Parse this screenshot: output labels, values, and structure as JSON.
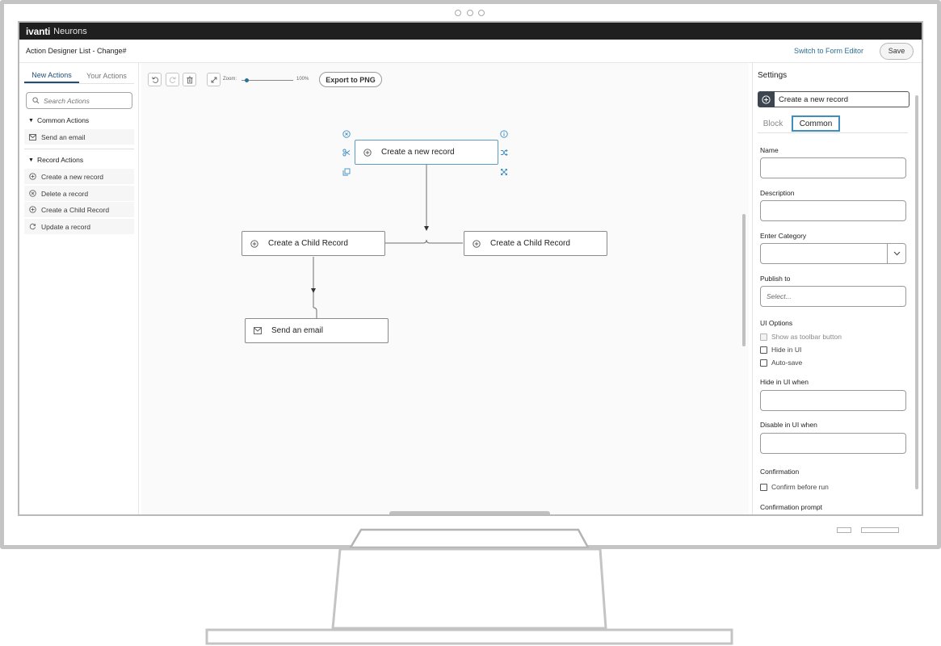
{
  "app": {
    "logo": "ivanti",
    "product": "Neurons"
  },
  "header": {
    "page_title": "Action Designer List - Change#",
    "form_editor_link": "Switch to Form Editor",
    "save_label": "Save"
  },
  "left_panel": {
    "tabs": [
      {
        "label": "New Actions",
        "active": true
      },
      {
        "label": "Your Actions",
        "active": false
      }
    ],
    "search_placeholder": "Search Actions",
    "sections": [
      {
        "title": "Common Actions",
        "items": [
          {
            "label": "Send an email",
            "icon": "mail-icon"
          }
        ]
      },
      {
        "title": "Record Actions",
        "items": [
          {
            "label": "Create a new record",
            "icon": "plus-circle-icon"
          },
          {
            "label": "Delete a record",
            "icon": "x-circle-icon"
          },
          {
            "label": "Create a Child Record",
            "icon": "plus-circle-icon"
          },
          {
            "label": "Update a record",
            "icon": "refresh-icon"
          }
        ]
      }
    ]
  },
  "toolbar": {
    "zoom_label": "Zoom:",
    "zoom_value": "100%",
    "zoom_level": 0.1,
    "export_label": "Export to PNG"
  },
  "canvas": {
    "nodes": [
      {
        "label": "Create a new record",
        "icon": "plus-circle-icon",
        "selected": true
      },
      {
        "label": "Create a Child Record",
        "icon": "plus-circle-icon",
        "selected": false
      },
      {
        "label": "Create a Child Record",
        "icon": "plus-circle-icon",
        "selected": false
      },
      {
        "label": "Send an email",
        "icon": "mail-icon",
        "selected": false
      }
    ]
  },
  "settings": {
    "title": "Settings",
    "block_name": "Create a new record",
    "tabs": [
      {
        "label": "Block",
        "active": false
      },
      {
        "label": "Common",
        "active": true
      }
    ],
    "fields": {
      "name_label": "Name",
      "name_value": "",
      "description_label": "Description",
      "description_value": "",
      "category_label": "Enter Category",
      "category_value": "",
      "publish_label": "Publish to",
      "publish_placeholder": "Select...",
      "ui_options_label": "UI Options",
      "hide_when_label": "Hide in UI when",
      "hide_when_value": "",
      "disable_when_label": "Disable in UI when",
      "disable_when_value": "",
      "confirmation_label": "Confirmation",
      "confirmation_prompt_label": "Confirmation prompt"
    },
    "ui_options": [
      {
        "label": "Show as toolbar button",
        "checked": false,
        "disabled": true
      },
      {
        "label": "Hide in UI",
        "checked": false,
        "disabled": false
      },
      {
        "label": "Auto-save",
        "checked": false,
        "disabled": false
      }
    ],
    "confirmation_options": [
      {
        "label": "Confirm before run",
        "checked": false
      }
    ]
  },
  "colors": {
    "accent": "#2a6f97",
    "topbar": "#1f1f1f",
    "selected_border": "#5a9cc4"
  }
}
